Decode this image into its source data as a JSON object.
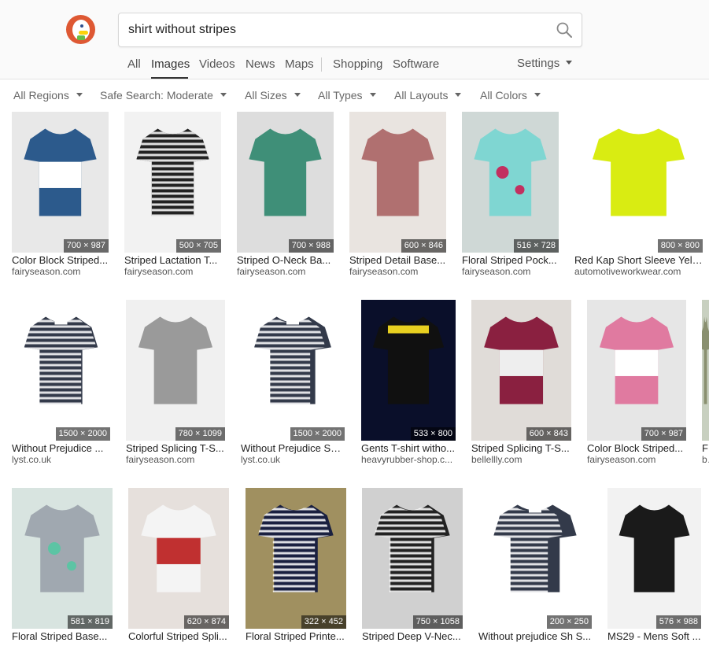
{
  "search": {
    "query": "shirt without stripes"
  },
  "nav": {
    "all": "All",
    "images": "Images",
    "videos": "Videos",
    "news": "News",
    "maps": "Maps",
    "shopping": "Shopping",
    "software": "Software",
    "settings": "Settings"
  },
  "filters": {
    "regions": "All Regions",
    "safe_search": "Safe Search: Moderate",
    "sizes": "All Sizes",
    "types": "All Types",
    "layouts": "All Layouts",
    "colors": "All Colors"
  },
  "results": [
    {
      "title": "Color Block Striped...",
      "source": "fairyseason.com",
      "dims": "700 × 987"
    },
    {
      "title": "Striped Lactation T...",
      "source": "fairyseason.com",
      "dims": "500 × 705"
    },
    {
      "title": "Striped O-Neck Ba...",
      "source": "fairyseason.com",
      "dims": "700 × 988"
    },
    {
      "title": "Striped Detail Base...",
      "source": "fairyseason.com",
      "dims": "600 × 846"
    },
    {
      "title": "Floral Striped Pock...",
      "source": "fairyseason.com",
      "dims": "516 × 728"
    },
    {
      "title": "Red Kap Short Sleeve Yell...",
      "source": "automotiveworkwear.com",
      "dims": "800 × 800"
    },
    {
      "title": "Without Prejudice ...",
      "source": "lyst.co.uk",
      "dims": "1500 × 2000"
    },
    {
      "title": "Striped Splicing T-S...",
      "source": "fairyseason.com",
      "dims": "780 × 1099"
    },
    {
      "title": "Without Prejudice Sh...",
      "source": "lyst.co.uk",
      "dims": "1500 × 2000"
    },
    {
      "title": "Gents T-shirt witho...",
      "source": "heavyrubber-shop.c...",
      "dims": "533 × 800"
    },
    {
      "title": "Striped Splicing T-S...",
      "source": "bellellly.com",
      "dims": "600 × 843"
    },
    {
      "title": "Color Block Striped...",
      "source": "fairyseason.com",
      "dims": "700 × 987"
    },
    {
      "title": "Fl",
      "source": "be",
      "dims": ""
    },
    {
      "title": "Floral Striped Base...",
      "source": "",
      "dims": "581 × 819"
    },
    {
      "title": "Colorful Striped Spli...",
      "source": "",
      "dims": "620 × 874"
    },
    {
      "title": "Floral Striped Printe...",
      "source": "",
      "dims": "322 × 452"
    },
    {
      "title": "Striped Deep V-Nec...",
      "source": "",
      "dims": "750 × 1058"
    },
    {
      "title": "Without prejudice Sh S...",
      "source": "",
      "dims": "200 × 250"
    },
    {
      "title": "MS29 - Mens Soft ...",
      "source": "",
      "dims": "576 × 988"
    }
  ],
  "colors": {
    "accent": "#de5833",
    "text": "#222222",
    "muted": "#666666"
  }
}
